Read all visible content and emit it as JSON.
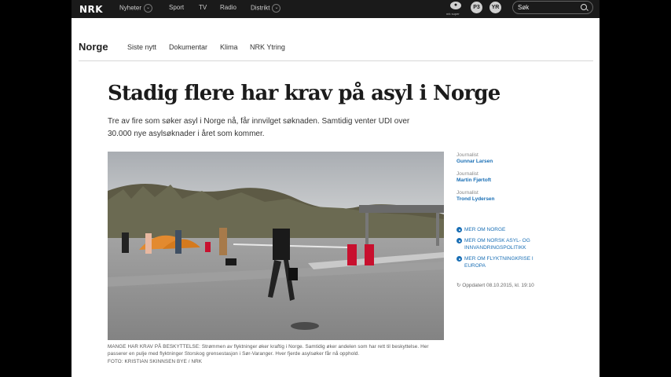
{
  "topbar": {
    "logo": "NRK",
    "nav": [
      {
        "label": "Nyheter",
        "has_chevron": true
      },
      {
        "label": "Sport",
        "has_chevron": false
      },
      {
        "label": "TV",
        "has_chevron": false
      },
      {
        "label": "Radio",
        "has_chevron": false
      },
      {
        "label": "Distrikt",
        "has_chevron": true
      }
    ],
    "icon_label": "nrk super",
    "icons": [
      "nrk-super-icon",
      "p3-icon",
      "yr-icon"
    ],
    "icon_texts": [
      "",
      "P3",
      "YR"
    ],
    "search_placeholder": "Søk"
  },
  "section": {
    "title": "Norge",
    "nav": [
      "Siste nytt",
      "Dokumentar",
      "Klima",
      "NRK Ytring"
    ]
  },
  "article": {
    "headline": "Stadig flere har krav på asyl i Norge",
    "lead": "Tre av fire som søker asyl i Norge nå, får innvilget søknaden. Samtidig venter UDI over 30.000 nye asylsøknader i året som kommer.",
    "caption": "MANGE HAR KRAV PÅ BESKYTTELSE: Strømmen av flyktninger øker kraftig i Norge. Samtidig øker andelen som har rett til beskyttelse. Her passerer en pulje med flyktninger Storskog grensestasjon i Sør-Varanger. Hver fjerde asylsøker får nå opphold.",
    "photo_credit": "FOTO: KRISTIAN SKINNSEN BYE / NRK"
  },
  "sidebar": {
    "bylines": [
      {
        "label": "Journalist",
        "name": "Gunnar Larsen"
      },
      {
        "label": "Journalist",
        "name": "Martin Fjørtoft"
      },
      {
        "label": "Journalist",
        "name": "Trond Lydersen"
      }
    ],
    "more_links": [
      "MER OM NORGE",
      "MER OM NORSK ASYL- OG INNVANDRINGSPOLITIKK",
      "MER OM FLYKTNINGKRISE I EUROPA"
    ],
    "updated": "Oppdatert 08.10.2015, kl. 19:10"
  },
  "colors": {
    "topbar_bg": "#1a1a1a",
    "link_blue": "#1a6fb5"
  }
}
